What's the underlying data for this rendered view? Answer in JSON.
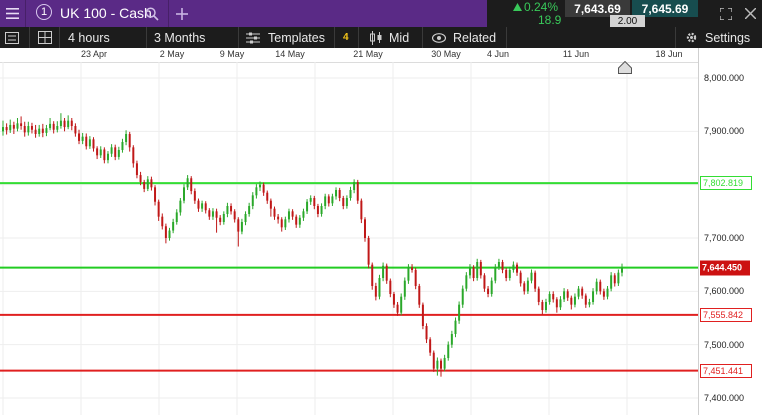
{
  "header": {
    "market_number": "1",
    "market_title": "UK 100 - Cash",
    "change_pct": "0.24%",
    "change_pts": "18.9",
    "sell_price": "7,643.69",
    "buy_price": "7,645.69",
    "spread": "2.00",
    "accent": "#5a2a86"
  },
  "toolbar": {
    "interval": "4 hours",
    "range": "3 Months",
    "templates_label": "Templates",
    "templates_count": "4",
    "price_type": "Mid",
    "related_label": "Related",
    "settings_label": "Settings"
  },
  "chart_data": {
    "type": "candlestick",
    "x_tick_labels": [
      "23 Apr",
      "2 May",
      "9 May",
      "14 May",
      "21 May",
      "30 May",
      "4 Jun",
      "11 Jun",
      "18 Jun"
    ],
    "y_tick_labels": [
      "8,000.000",
      "7,900.000",
      "7,800.000",
      "7,700.000",
      "7,600.000",
      "7,500.000",
      "7,400.000"
    ],
    "y_ticks": [
      8000,
      7900,
      7800,
      7700,
      7600,
      7500,
      7400
    ],
    "ylim": [
      7370,
      8030
    ],
    "grid": true,
    "up_color": "#2aa82a",
    "down_color": "#c01818",
    "horizontal_lines": [
      {
        "value": 7802.819,
        "label": "7,802.819",
        "color": "#33dd33"
      },
      {
        "value": 7644.45,
        "label": "7,644.450",
        "color": "#22cc22"
      },
      {
        "value": 7555.842,
        "label": "7,555.842",
        "color": "#e02020"
      },
      {
        "value": 7451.441,
        "label": "7,451.441",
        "color": "#e02020"
      }
    ],
    "current_price": {
      "value": 7644.45,
      "label": "7,644.450",
      "color": "#cc1111"
    },
    "candles": [
      [
        7900,
        7908,
        7920,
        7892
      ],
      [
        7908,
        7902,
        7915,
        7894
      ],
      [
        7902,
        7912,
        7922,
        7897
      ],
      [
        7912,
        7905,
        7918,
        7895
      ],
      [
        7905,
        7915,
        7925,
        7900
      ],
      [
        7915,
        7910,
        7928,
        7903
      ],
      [
        7910,
        7898,
        7918,
        7890
      ],
      [
        7898,
        7910,
        7918,
        7892
      ],
      [
        7910,
        7903,
        7916,
        7896
      ],
      [
        7903,
        7895,
        7912,
        7888
      ],
      [
        7895,
        7905,
        7912,
        7890
      ],
      [
        7905,
        7897,
        7914,
        7889
      ],
      [
        7897,
        7906,
        7912,
        7891
      ],
      [
        7906,
        7914,
        7925,
        7902
      ],
      [
        7914,
        7903,
        7919,
        7896
      ],
      [
        7903,
        7910,
        7919,
        7898
      ],
      [
        7910,
        7920,
        7934,
        7905
      ],
      [
        7920,
        7908,
        7925,
        7900
      ],
      [
        7908,
        7920,
        7930,
        7904
      ],
      [
        7920,
        7910,
        7925,
        7902
      ],
      [
        7910,
        7896,
        7915,
        7890
      ],
      [
        7896,
        7882,
        7903,
        7876
      ],
      [
        7882,
        7890,
        7897,
        7876
      ],
      [
        7890,
        7872,
        7896,
        7866
      ],
      [
        7872,
        7885,
        7891,
        7867
      ],
      [
        7885,
        7868,
        7889,
        7862
      ],
      [
        7868,
        7855,
        7872,
        7848
      ],
      [
        7855,
        7866,
        7872,
        7850
      ],
      [
        7866,
        7846,
        7870,
        7840
      ],
      [
        7846,
        7858,
        7863,
        7840
      ],
      [
        7858,
        7870,
        7876,
        7852
      ],
      [
        7870,
        7852,
        7875,
        7846
      ],
      [
        7852,
        7865,
        7871,
        7847
      ],
      [
        7865,
        7880,
        7886,
        7860
      ],
      [
        7880,
        7895,
        7902,
        7874
      ],
      [
        7895,
        7870,
        7899,
        7862
      ],
      [
        7870,
        7840,
        7874,
        7832
      ],
      [
        7840,
        7818,
        7845,
        7812
      ],
      [
        7818,
        7805,
        7824,
        7799
      ],
      [
        7805,
        7792,
        7809,
        7786
      ],
      [
        7792,
        7810,
        7816,
        7788
      ],
      [
        7810,
        7795,
        7815,
        7789
      ],
      [
        7795,
        7768,
        7799,
        7761
      ],
      [
        7768,
        7740,
        7772,
        7732
      ],
      [
        7740,
        7722,
        7746,
        7716
      ],
      [
        7722,
        7700,
        7727,
        7690
      ],
      [
        7700,
        7714,
        7719,
        7695
      ],
      [
        7714,
        7730,
        7736,
        7709
      ],
      [
        7730,
        7748,
        7754,
        7725
      ],
      [
        7748,
        7770,
        7775,
        7742
      ],
      [
        7770,
        7795,
        7801,
        7765
      ],
      [
        7795,
        7812,
        7818,
        7790
      ],
      [
        7812,
        7788,
        7816,
        7782
      ],
      [
        7788,
        7770,
        7793,
        7764
      ],
      [
        7770,
        7755,
        7774,
        7749
      ],
      [
        7755,
        7765,
        7770,
        7749
      ],
      [
        7765,
        7752,
        7769,
        7746
      ],
      [
        7752,
        7740,
        7756,
        7734
      ],
      [
        7740,
        7750,
        7756,
        7734
      ],
      [
        7750,
        7738,
        7755,
        7710
      ],
      [
        7738,
        7730,
        7743,
        7724
      ],
      [
        7730,
        7745,
        7750,
        7725
      ],
      [
        7745,
        7760,
        7766,
        7739
      ],
      [
        7760,
        7750,
        7765,
        7744
      ],
      [
        7750,
        7735,
        7754,
        7729
      ],
      [
        7735,
        7712,
        7739,
        7684
      ],
      [
        7712,
        7730,
        7736,
        7707
      ],
      [
        7730,
        7745,
        7750,
        7724
      ],
      [
        7745,
        7760,
        7766,
        7740
      ],
      [
        7760,
        7780,
        7786,
        7754
      ],
      [
        7780,
        7795,
        7801,
        7774
      ],
      [
        7795,
        7800,
        7806,
        7788
      ],
      [
        7800,
        7785,
        7804,
        7779
      ],
      [
        7785,
        7770,
        7789,
        7764
      ],
      [
        7770,
        7755,
        7774,
        7740
      ],
      [
        7755,
        7740,
        7759,
        7734
      ],
      [
        7740,
        7735,
        7745,
        7727
      ],
      [
        7735,
        7720,
        7739,
        7712
      ],
      [
        7720,
        7735,
        7740,
        7715
      ],
      [
        7735,
        7750,
        7755,
        7729
      ],
      [
        7750,
        7740,
        7754,
        7734
      ],
      [
        7740,
        7725,
        7744,
        7719
      ],
      [
        7725,
        7738,
        7743,
        7719
      ],
      [
        7738,
        7750,
        7755,
        7732
      ],
      [
        7750,
        7768,
        7773,
        7745
      ],
      [
        7768,
        7775,
        7780,
        7762
      ],
      [
        7775,
        7760,
        7779,
        7754
      ],
      [
        7760,
        7745,
        7764,
        7739
      ],
      [
        7745,
        7760,
        7765,
        7740
      ],
      [
        7760,
        7778,
        7783,
        7754
      ],
      [
        7778,
        7765,
        7782,
        7759
      ],
      [
        7765,
        7778,
        7783,
        7760
      ],
      [
        7778,
        7790,
        7795,
        7772
      ],
      [
        7790,
        7775,
        7794,
        7769
      ],
      [
        7775,
        7760,
        7779,
        7754
      ],
      [
        7760,
        7775,
        7780,
        7755
      ],
      [
        7775,
        7790,
        7796,
        7770
      ],
      [
        7790,
        7805,
        7810,
        7784
      ],
      [
        7805,
        7770,
        7809,
        7764
      ],
      [
        7770,
        7735,
        7774,
        7728
      ],
      [
        7735,
        7700,
        7739,
        7693
      ],
      [
        7700,
        7650,
        7704,
        7643
      ],
      [
        7650,
        7610,
        7654,
        7603
      ],
      [
        7610,
        7590,
        7616,
        7583
      ],
      [
        7590,
        7625,
        7631,
        7585
      ],
      [
        7625,
        7648,
        7654,
        7619
      ],
      [
        7648,
        7620,
        7652,
        7614
      ],
      [
        7620,
        7595,
        7624,
        7589
      ],
      [
        7595,
        7575,
        7599,
        7569
      ],
      [
        7575,
        7560,
        7580,
        7554
      ],
      [
        7560,
        7590,
        7596,
        7555
      ],
      [
        7590,
        7620,
        7626,
        7584
      ],
      [
        7620,
        7645,
        7651,
        7614
      ],
      [
        7645,
        7640,
        7651,
        7635
      ],
      [
        7640,
        7610,
        7644,
        7604
      ],
      [
        7610,
        7575,
        7614,
        7569
      ],
      [
        7575,
        7535,
        7579,
        7529
      ],
      [
        7535,
        7510,
        7540,
        7503
      ],
      [
        7510,
        7485,
        7514,
        7479
      ],
      [
        7485,
        7455,
        7489,
        7449
      ],
      [
        7455,
        7470,
        7476,
        7442
      ],
      [
        7470,
        7455,
        7474,
        7440
      ],
      [
        7455,
        7475,
        7481,
        7450
      ],
      [
        7475,
        7500,
        7506,
        7470
      ],
      [
        7500,
        7520,
        7526,
        7494
      ],
      [
        7520,
        7545,
        7551,
        7514
      ],
      [
        7545,
        7575,
        7581,
        7539
      ],
      [
        7575,
        7605,
        7611,
        7569
      ],
      [
        7605,
        7630,
        7636,
        7600
      ],
      [
        7630,
        7645,
        7651,
        7624
      ],
      [
        7645,
        7625,
        7649,
        7619
      ],
      [
        7625,
        7655,
        7661,
        7620
      ],
      [
        7655,
        7630,
        7659,
        7624
      ],
      [
        7630,
        7605,
        7634,
        7599
      ],
      [
        7605,
        7595,
        7610,
        7589
      ],
      [
        7595,
        7620,
        7626,
        7590
      ],
      [
        7620,
        7645,
        7651,
        7615
      ],
      [
        7645,
        7655,
        7661,
        7640
      ],
      [
        7655,
        7640,
        7659,
        7634
      ],
      [
        7640,
        7625,
        7644,
        7619
      ],
      [
        7625,
        7640,
        7646,
        7620
      ],
      [
        7640,
        7650,
        7656,
        7635
      ],
      [
        7650,
        7635,
        7654,
        7629
      ],
      [
        7635,
        7615,
        7639,
        7609
      ],
      [
        7615,
        7600,
        7619,
        7594
      ],
      [
        7600,
        7620,
        7626,
        7595
      ],
      [
        7620,
        7635,
        7641,
        7615
      ],
      [
        7635,
        7605,
        7639,
        7599
      ],
      [
        7605,
        7580,
        7609,
        7574
      ],
      [
        7580,
        7565,
        7584,
        7556
      ],
      [
        7565,
        7580,
        7586,
        7560
      ],
      [
        7580,
        7595,
        7600,
        7575
      ],
      [
        7595,
        7585,
        7600,
        7579
      ],
      [
        7585,
        7570,
        7589,
        7560
      ],
      [
        7570,
        7585,
        7591,
        7565
      ],
      [
        7585,
        7600,
        7606,
        7580
      ],
      [
        7600,
        7588,
        7604,
        7582
      ],
      [
        7588,
        7575,
        7592,
        7566
      ],
      [
        7575,
        7590,
        7596,
        7570
      ],
      [
        7590,
        7605,
        7610,
        7585
      ],
      [
        7605,
        7592,
        7609,
        7586
      ],
      [
        7592,
        7575,
        7596,
        7569
      ],
      [
        7575,
        7580,
        7586,
        7570
      ],
      [
        7580,
        7600,
        7606,
        7575
      ],
      [
        7600,
        7618,
        7624,
        7594
      ],
      [
        7618,
        7600,
        7622,
        7594
      ],
      [
        7600,
        7590,
        7605,
        7584
      ],
      [
        7590,
        7605,
        7610,
        7585
      ],
      [
        7605,
        7630,
        7636,
        7600
      ],
      [
        7630,
        7615,
        7634,
        7609
      ],
      [
        7615,
        7635,
        7641,
        7610
      ],
      [
        7635,
        7644,
        7652,
        7628
      ]
    ]
  }
}
